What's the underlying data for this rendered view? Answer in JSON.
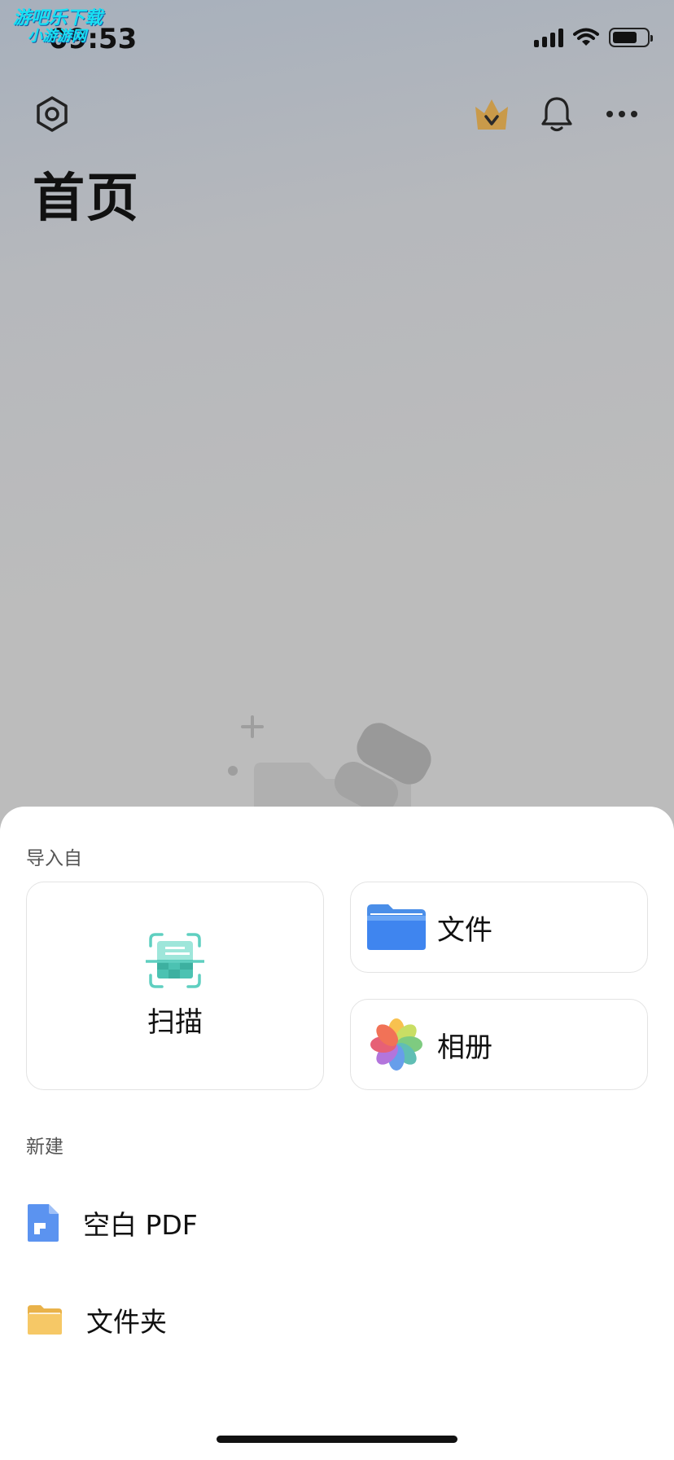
{
  "watermark": {
    "line1": "游吧乐下载",
    "line2": "小游游网"
  },
  "status_bar": {
    "time": "09:53"
  },
  "header": {
    "settings_icon": "hexagon-gear-icon",
    "vip_icon": "crown-icon",
    "notification_icon": "bell-icon",
    "more_icon": "more-horizontal-icon",
    "title": "首页"
  },
  "sheet": {
    "import_label": "导入自",
    "scan_label": "扫描",
    "files_label": "文件",
    "album_label": "相册",
    "new_label": "新建",
    "new_items": [
      {
        "label": "空白 PDF",
        "icon": "pdf-file-icon"
      },
      {
        "label": "文件夹",
        "icon": "folder-icon"
      }
    ]
  },
  "colors": {
    "scan_teal": "#5fcfc0",
    "file_blue": "#3c82ee",
    "folder_yellow": "#f6c866",
    "pdf_blue": "#5b93f0"
  }
}
